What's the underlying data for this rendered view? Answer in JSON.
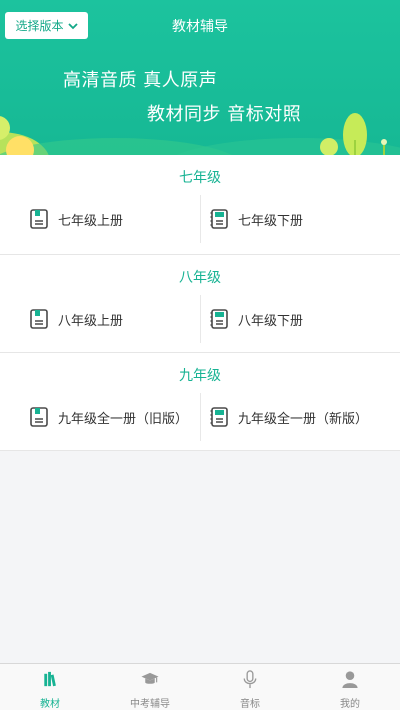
{
  "header": {
    "version_button": "选择版本",
    "title": "教材辅导",
    "slogan_line1": "高清音质 真人原声",
    "slogan_line2": "教材同步 音标对照"
  },
  "colors": {
    "accent": "#17b393",
    "banner": "#1cc39e",
    "book_icon": "#4a4a4a",
    "book_mark": "#17b393"
  },
  "grades": [
    {
      "title": "七年级",
      "books": [
        "七年级上册",
        "七年级下册"
      ]
    },
    {
      "title": "八年级",
      "books": [
        "八年级上册",
        "八年级下册"
      ]
    },
    {
      "title": "九年级",
      "books": [
        "九年级全一册（旧版）",
        "九年级全一册（新版）"
      ]
    }
  ],
  "nav": {
    "items": [
      {
        "label": "教材",
        "icon": "books-icon",
        "active": true
      },
      {
        "label": "中考辅导",
        "icon": "graduation-cap-icon",
        "active": false
      },
      {
        "label": "音标",
        "icon": "microphone-icon",
        "active": false
      },
      {
        "label": "我的",
        "icon": "person-icon",
        "active": false
      }
    ]
  }
}
